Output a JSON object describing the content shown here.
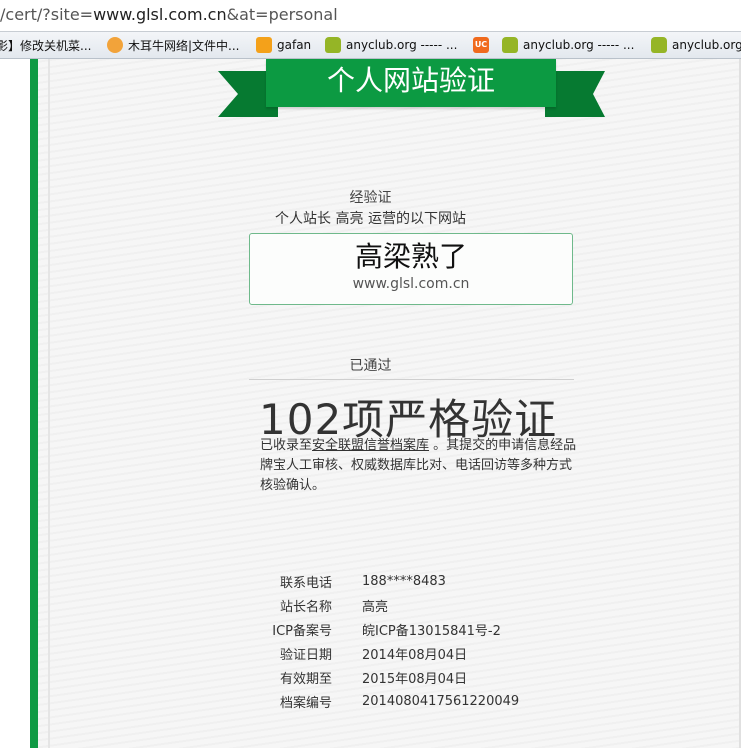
{
  "browser": {
    "url_prefix": "/cert/?site=",
    "url_host": "www.glsl.com.cn",
    "url_suffix": "&at=personal"
  },
  "bookmarks": [
    {
      "label": "影】修改关机菜...",
      "icon": "none"
    },
    {
      "label": "木耳牛网络|文件中...",
      "icon": "fire-icon"
    },
    {
      "label": "gafan",
      "icon": "orange-icon"
    },
    {
      "label": "anyclub.org ----- ...",
      "icon": "android-icon"
    },
    {
      "label": "anyclub.org ----- ...",
      "icon": "android-icon"
    },
    {
      "label": "anyclub.org",
      "icon": "android-icon"
    }
  ],
  "cert": {
    "banner_title": "个人网站验证",
    "verified_label": "经验证",
    "operator_line": "个人站长 高亮 运营的以下网站",
    "site_name": "高梁熟了",
    "site_domain": "www.glsl.com.cn",
    "passed_label": "已通过",
    "big_title": "102项严格验证",
    "desc_prefix": "已收录至",
    "desc_link": "安全联盟信誉档案库",
    "desc_suffix": " 。其提交的申请信息经品牌宝人工审核、权威数据库比对、电话回访等多种方式核验确认。"
  },
  "info_rows": [
    {
      "key": "联系电话",
      "value": "188****8483"
    },
    {
      "key": "站长名称",
      "value": "高亮"
    },
    {
      "key": "ICP备案号",
      "value": "皖ICP备13015841号-2"
    },
    {
      "key": "验证日期",
      "value": "2014年08月04日"
    },
    {
      "key": "有效期至",
      "value": "2015年08月04日"
    },
    {
      "key": "档案编号",
      "value": "2014080417561220049"
    }
  ],
  "colors": {
    "brand_green": "#0c9a42",
    "ribbon_dark": "#067a31",
    "box_border": "#6fb98b"
  }
}
